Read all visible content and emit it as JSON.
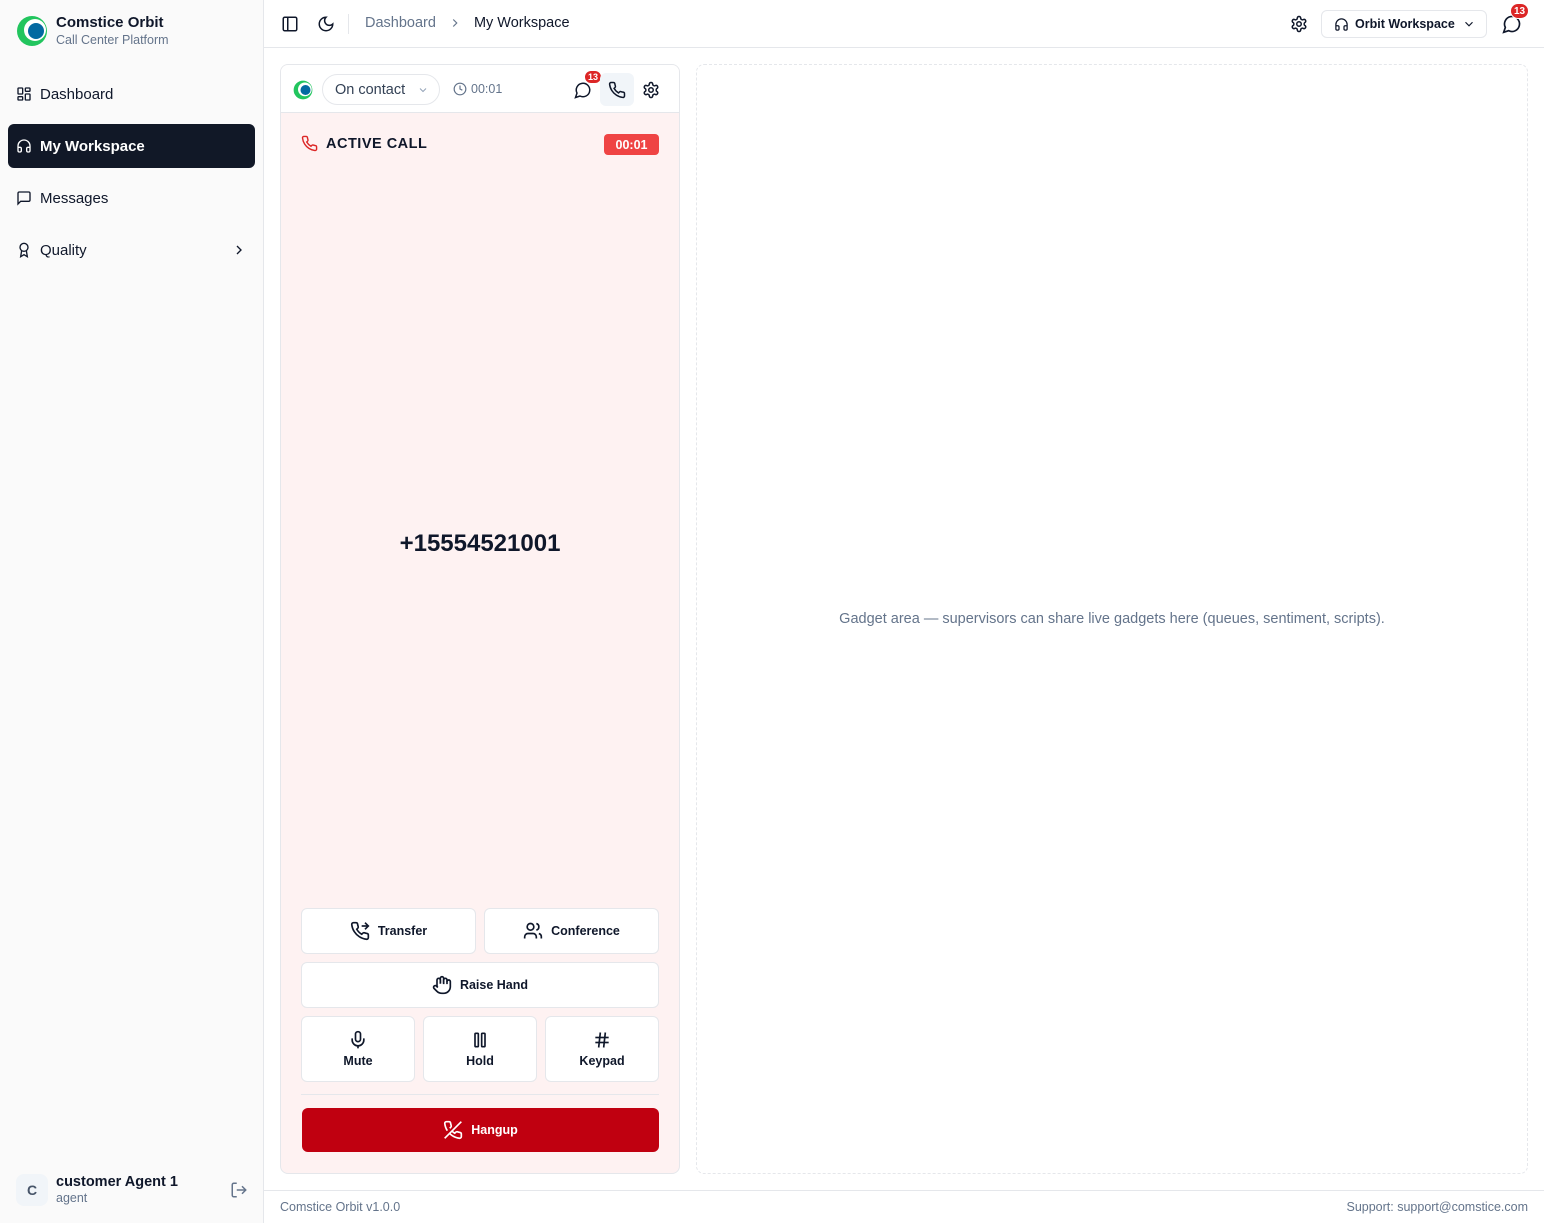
{
  "brand": {
    "title": "Comstice Orbit",
    "subtitle": "Call Center Platform"
  },
  "sidebar": {
    "items": [
      {
        "label": "Dashboard",
        "icon": "layout-grid-icon"
      },
      {
        "label": "My Workspace",
        "icon": "headphones-icon",
        "active": true
      },
      {
        "label": "Messages",
        "icon": "message-square-icon"
      },
      {
        "label": "Quality",
        "icon": "award-icon",
        "has_submenu": true
      }
    ]
  },
  "user": {
    "initial": "C",
    "name": "customer Agent 1",
    "role": "agent"
  },
  "topbar": {
    "breadcrumb": {
      "parent": "Dashboard",
      "current": "My Workspace"
    },
    "workspace_button": "Orbit Workspace",
    "notification_count": "13"
  },
  "softphone": {
    "status": "On contact",
    "elapsed": "00:01",
    "message_count": "13",
    "call_title": "ACTIVE CALL",
    "call_timer": "00:01",
    "phone_number": "+15554521001",
    "actions": {
      "transfer": "Transfer",
      "conference": "Conference",
      "raise_hand": "Raise Hand",
      "mute": "Mute",
      "hold": "Hold",
      "keypad": "Keypad",
      "hangup": "Hangup"
    }
  },
  "gadget": {
    "text": "Gadget area — supervisors can share live gadgets here (queues, sentiment, scripts)."
  },
  "footer": {
    "version": "Comstice Orbit v1.0.0",
    "support": "Support: support@comstice.com"
  },
  "colors": {
    "active_nav": "#111827",
    "hangup": "#c00010",
    "call_bg": "#fef2f2",
    "badge": "#dc2626"
  }
}
